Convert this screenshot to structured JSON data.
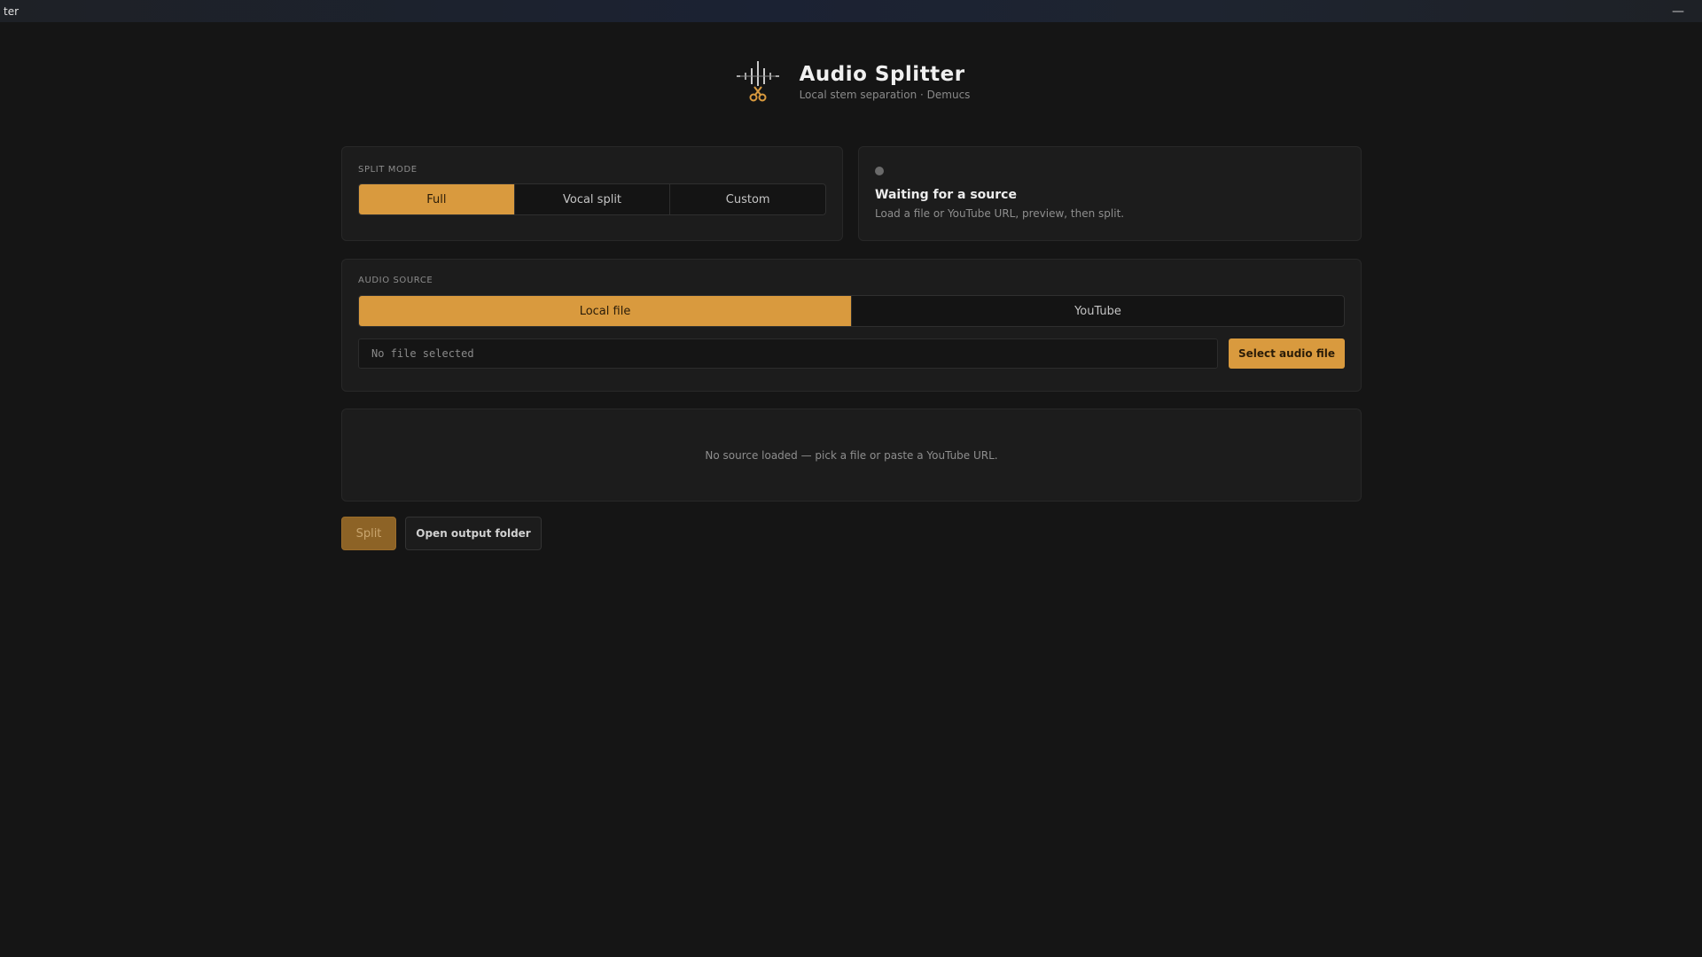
{
  "window": {
    "title": "ter",
    "minimize_glyph": "—"
  },
  "header": {
    "logo_icon": "waveform-scissors-icon",
    "title": "Audio Splitter",
    "subtitle": "Local stem separation · Demucs"
  },
  "split_mode": {
    "label": "SPLIT MODE",
    "options": [
      "Full",
      "Vocal split",
      "Custom"
    ],
    "selected": "Full"
  },
  "status": {
    "title": "Waiting for a source",
    "description": "Load a file or YouTube URL, preview, then split."
  },
  "audio_source": {
    "label": "AUDIO SOURCE",
    "tabs": [
      "Local file",
      "YouTube"
    ],
    "selected": "Local file",
    "file_field_value": "No file selected",
    "select_button": "Select audio file"
  },
  "preview": {
    "empty_message": "No source loaded — pick a file or paste a YouTube URL."
  },
  "actions": {
    "split_button": "Split",
    "open_folder_button": "Open output folder"
  },
  "colors": {
    "accent": "#d99a3e",
    "background": "#151515",
    "card": "#1c1c1c"
  }
}
